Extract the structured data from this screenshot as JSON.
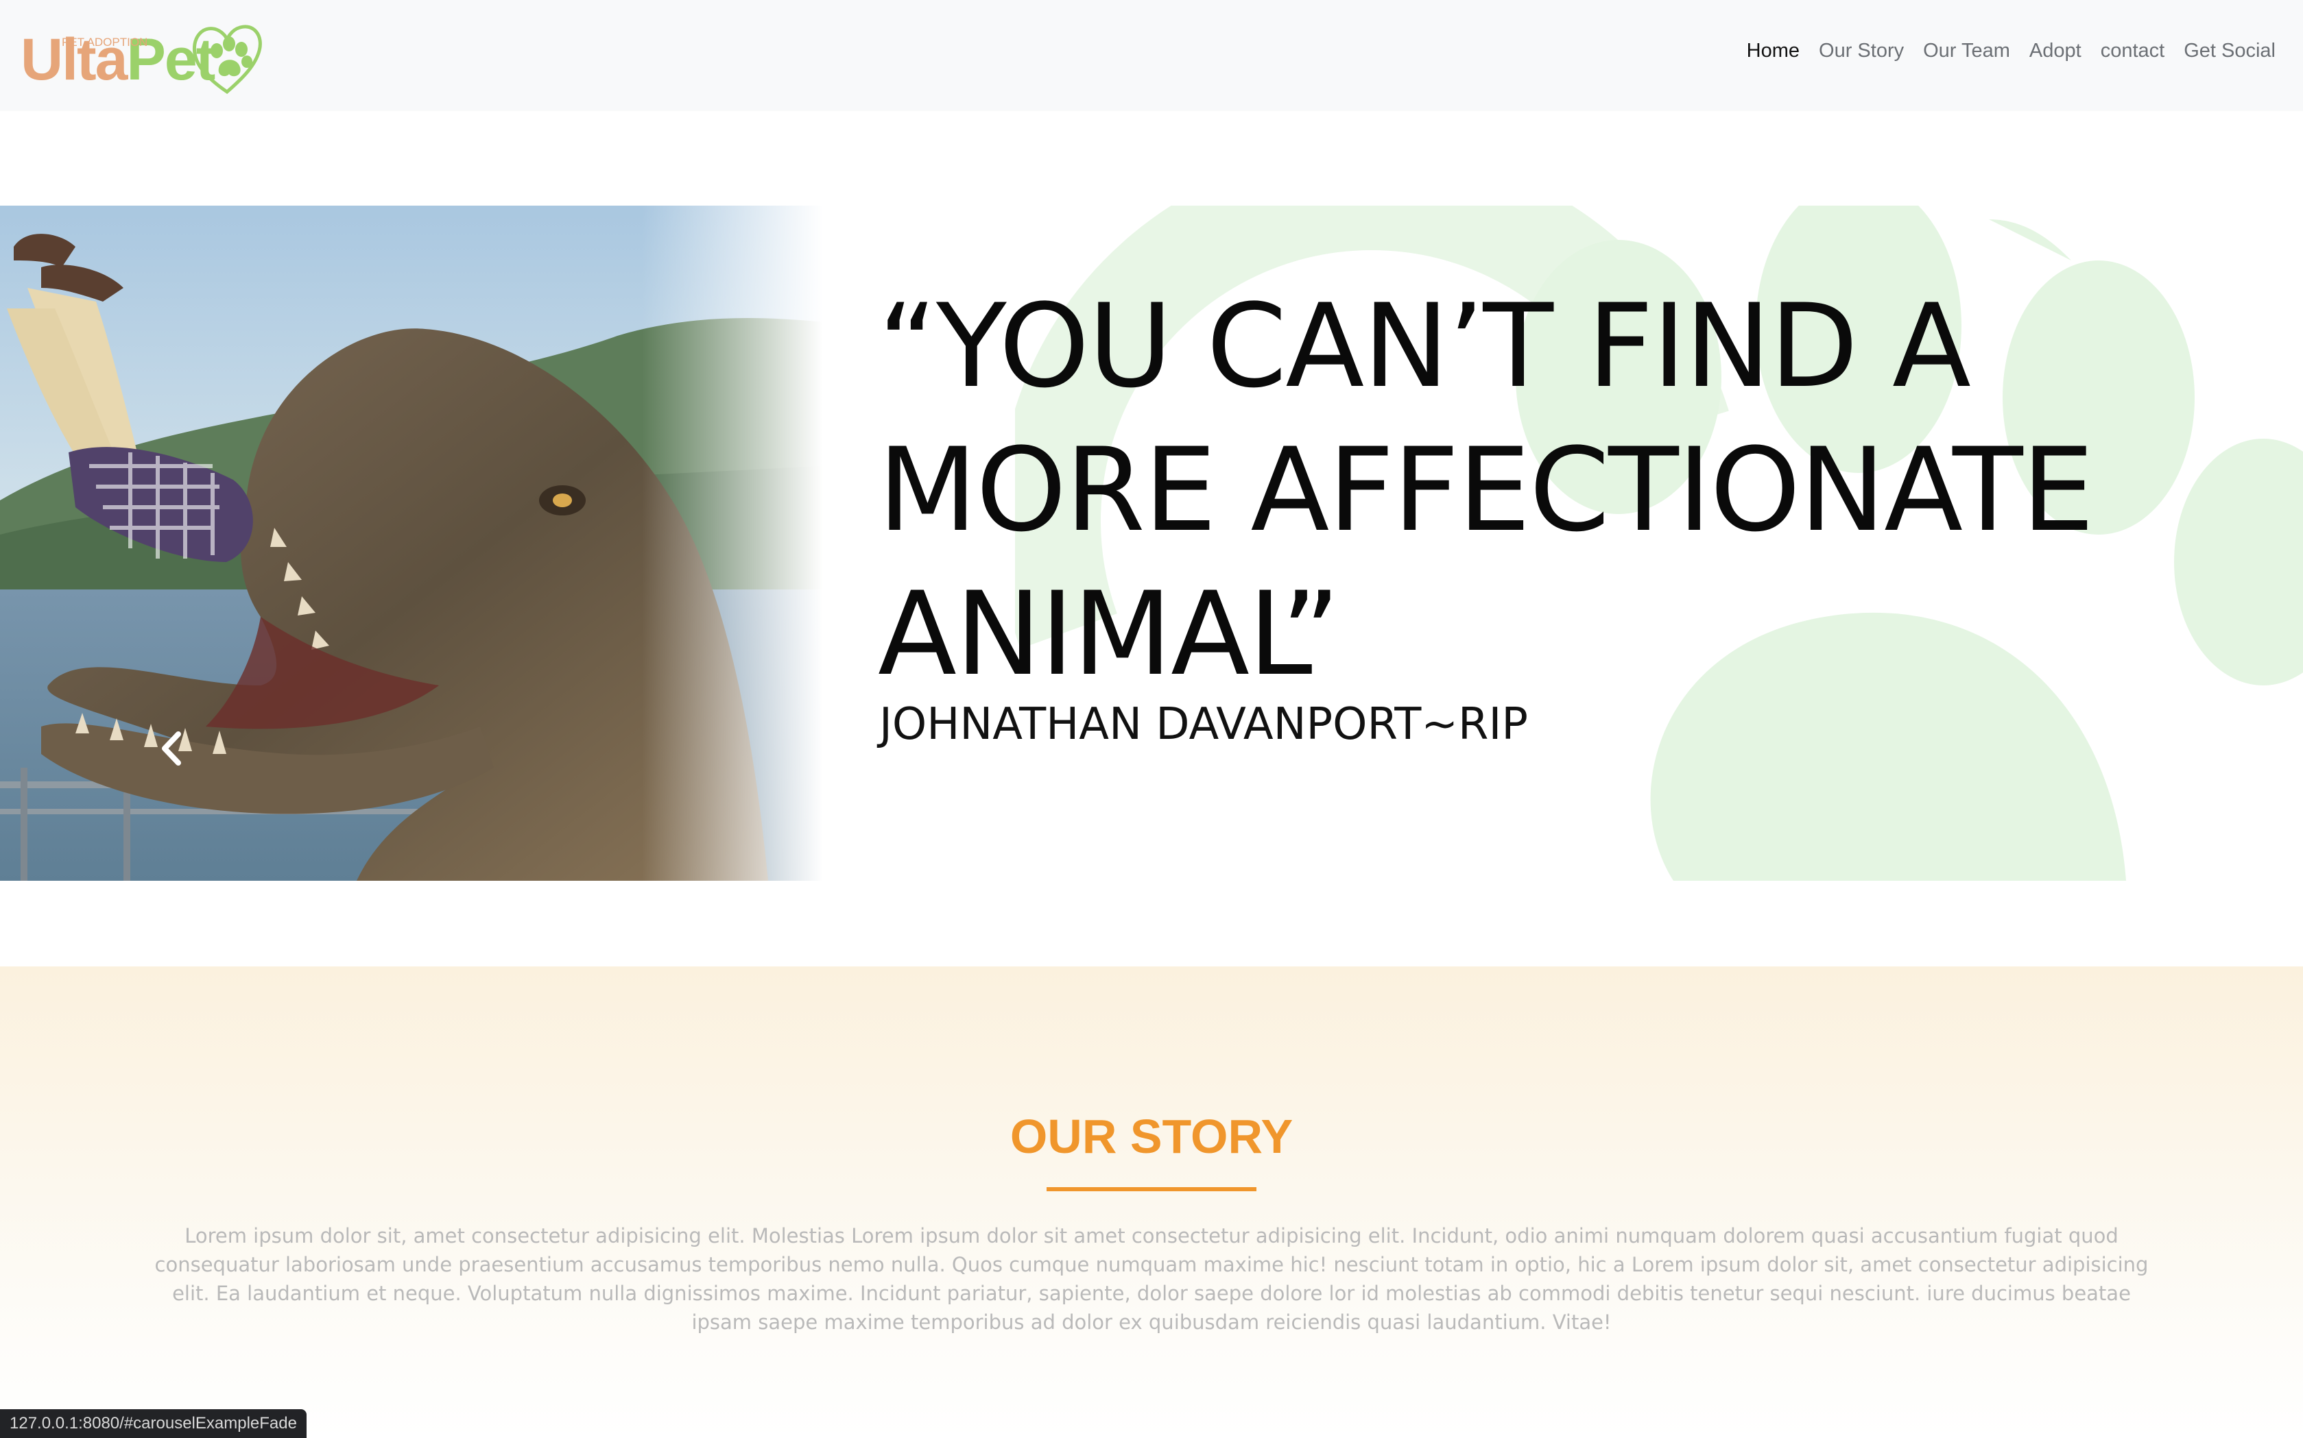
{
  "brand": {
    "name_part1": "Ulta",
    "name_part2": "Pet",
    "tagline": "PET ADOPTION",
    "icon": "paw-heart-logo-icon",
    "colors": {
      "peach": "#e6a579",
      "green": "#9bd16a"
    }
  },
  "nav": {
    "items": [
      {
        "label": "Home",
        "active": true
      },
      {
        "label": "Our Story",
        "active": false
      },
      {
        "label": "Our Team",
        "active": false
      },
      {
        "label": "Adopt",
        "active": false
      },
      {
        "label": "contact",
        "active": false
      },
      {
        "label": "Get Social",
        "active": false
      }
    ]
  },
  "hero": {
    "quote_lines": [
      "“YOU CAN’T FIND A",
      "MORE AFFECTIONATE",
      "ANIMAL”"
    ],
    "author": "JOHNATHAN DAVANPORT~RIP",
    "prev_icon": "chevron-left-icon",
    "image_subject": "t-rex-photo"
  },
  "story": {
    "title": "OUR STORY",
    "accent_color": "#f0962c",
    "body": "Lorem ipsum dolor sit, amet consectetur adipisicing elit. Molestias Lorem ipsum dolor sit amet consectetur adipisicing elit. Incidunt, odio animi numquam dolorem quasi accusantium fugiat quod consequatur laboriosam unde praesentium accusamus temporibus nemo nulla. Quos cumque numquam maxime hic! nesciunt totam in optio, hic a Lorem ipsum dolor sit, amet consectetur adipisicing elit. Ea laudantium et neque. Voluptatum nulla dignissimos maxime. Incidunt pariatur, sapiente, dolor saepe dolore lor id molestias ab commodi debitis tenetur sequi nesciunt. iure ducimus beatae ipsam saepe maxime temporibus ad dolor ex quibusdam reiciendis quasi laudantium. Vitae!"
  },
  "status_bar": {
    "url": "127.0.0.1:8080/#carouselExampleFade"
  }
}
